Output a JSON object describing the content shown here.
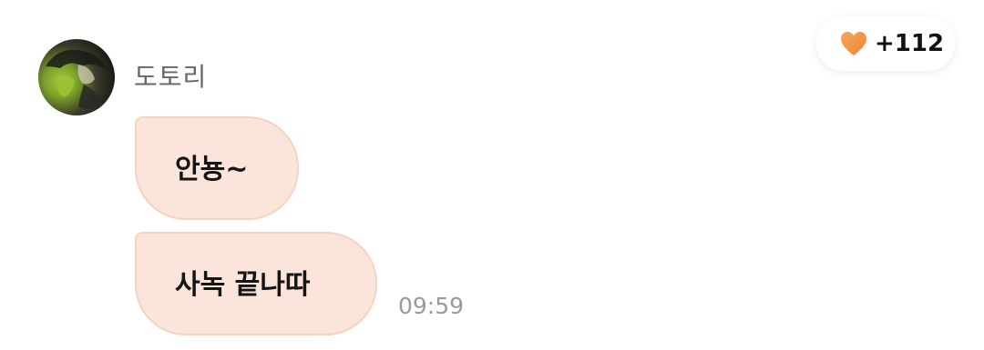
{
  "message_group": {
    "sender": {
      "name": "도토리",
      "avatar_icon": "profile-photo"
    },
    "messages": [
      {
        "text": "안뇽~"
      },
      {
        "text": "사녹 끝나따"
      }
    ],
    "timestamp": "09:59",
    "bubble_color": "#fbe4d9",
    "bubble_border_color": "#f4d3c3"
  },
  "reaction": {
    "icon": "heart-icon",
    "color": "#f0913e",
    "count": "+112"
  }
}
